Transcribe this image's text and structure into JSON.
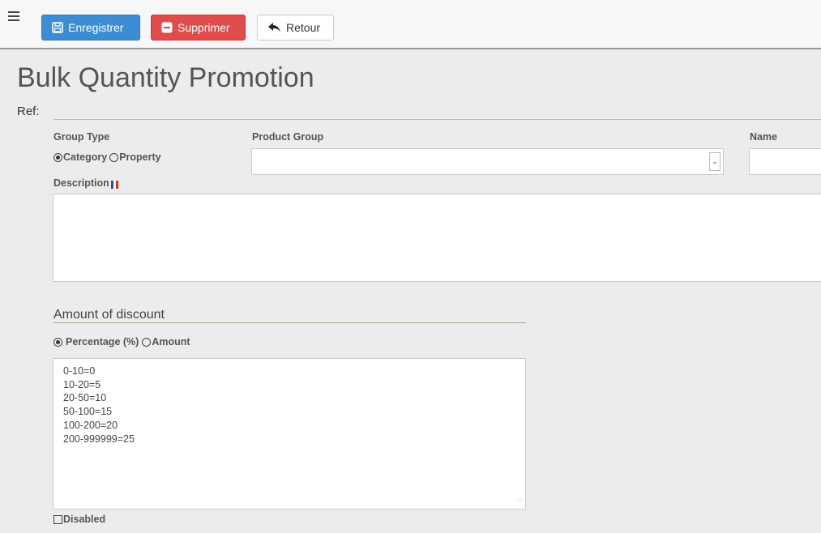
{
  "toolbar": {
    "save_label": "Enregistrer",
    "delete_label": "Supprimer",
    "back_label": "Retour"
  },
  "page": {
    "title": "Bulk Quantity Promotion",
    "ref_label": "Ref:"
  },
  "form": {
    "group_type": {
      "label": "Group Type",
      "options": [
        "Category",
        "Property"
      ],
      "selected": "Category"
    },
    "product_group": {
      "label": "Product Group",
      "value": ""
    },
    "name": {
      "label": "Name",
      "value": ""
    },
    "description": {
      "label": "Description",
      "value": "",
      "language_flag": "fr"
    }
  },
  "discount": {
    "section_title": "Amount of discount",
    "type_options": [
      "Percentage (%)",
      "Amount"
    ],
    "selected_type": "Percentage (%)",
    "tiers": [
      "0-10=0",
      "10-20=5",
      "20-50=10",
      "50-100=15",
      "100-200=20",
      "200-999999=25"
    ],
    "disabled_label": "Disabled",
    "disabled_checked": false
  },
  "colors": {
    "save": "#3c8dd4",
    "delete": "#e04b4b",
    "background": "#ececec"
  }
}
